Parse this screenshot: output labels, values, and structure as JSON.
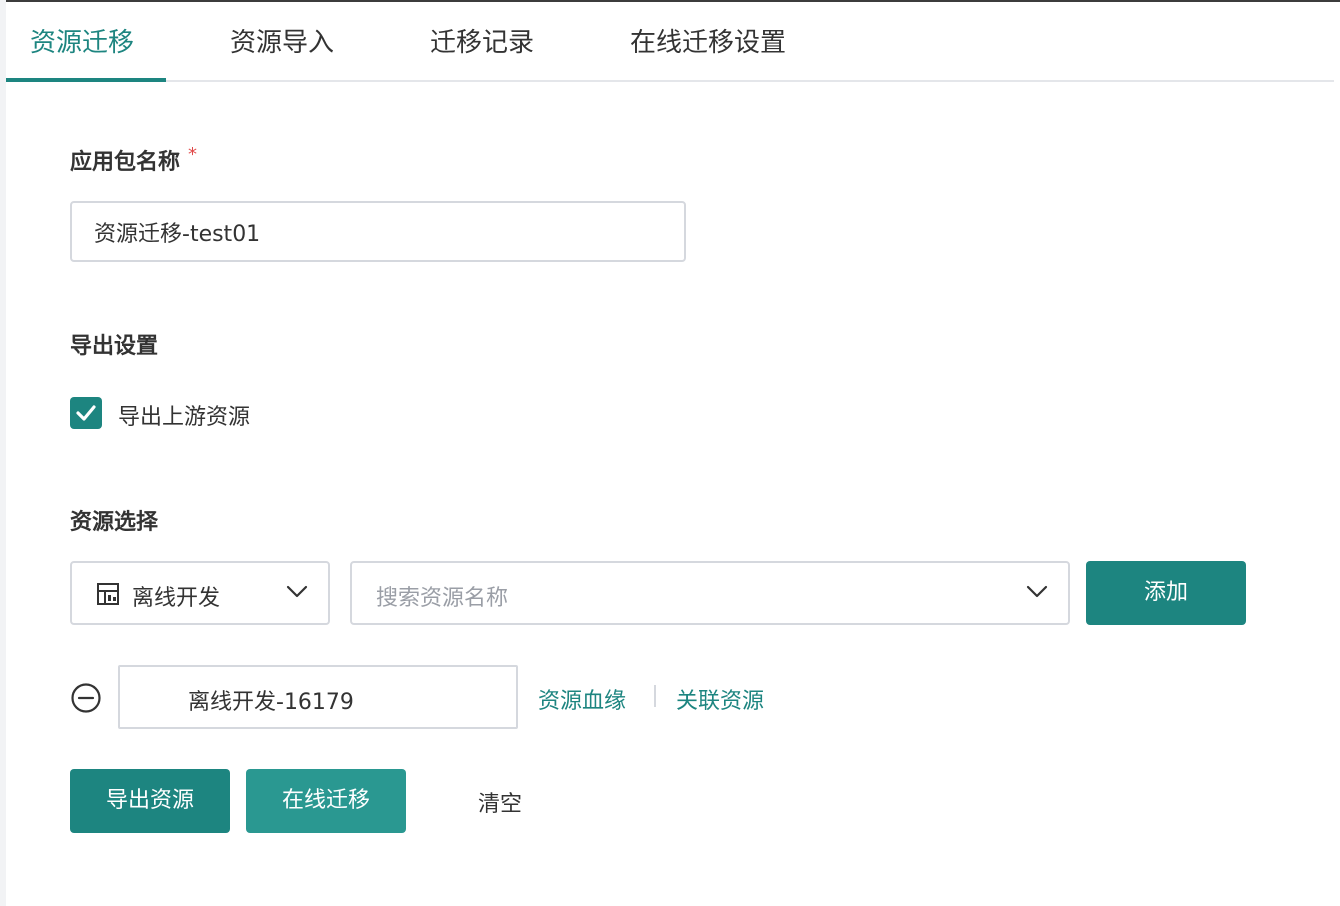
{
  "tabs": [
    {
      "label": "资源迁移",
      "active": true
    },
    {
      "label": "资源导入",
      "active": false
    },
    {
      "label": "迁移记录",
      "active": false
    },
    {
      "label": "在线迁移设置",
      "active": false
    }
  ],
  "form": {
    "package_name_label": "应用包名称",
    "required_mark": "*",
    "package_name_value": "资源迁移-test01",
    "export_settings_label": "导出设置",
    "export_upstream_label": "导出上游资源",
    "export_upstream_checked": true,
    "resource_select_label": "资源选择",
    "resource_type_value": "离线开发",
    "resource_type_icon": "table-icon",
    "search_placeholder": "搜索资源名称",
    "add_button": "添加"
  },
  "selected_resources": [
    {
      "name": "离线开发-16179",
      "lineage_link": "资源血缘",
      "related_link": "关联资源"
    }
  ],
  "actions": {
    "export_button": "导出资源",
    "migrate_button": "在线迁移",
    "clear_button": "清空"
  },
  "colors": {
    "accent": "#1d8580",
    "accent_light": "#2a9891",
    "required": "#e04a4a",
    "border": "#d5d8de",
    "placeholder": "#9a9ea6"
  }
}
